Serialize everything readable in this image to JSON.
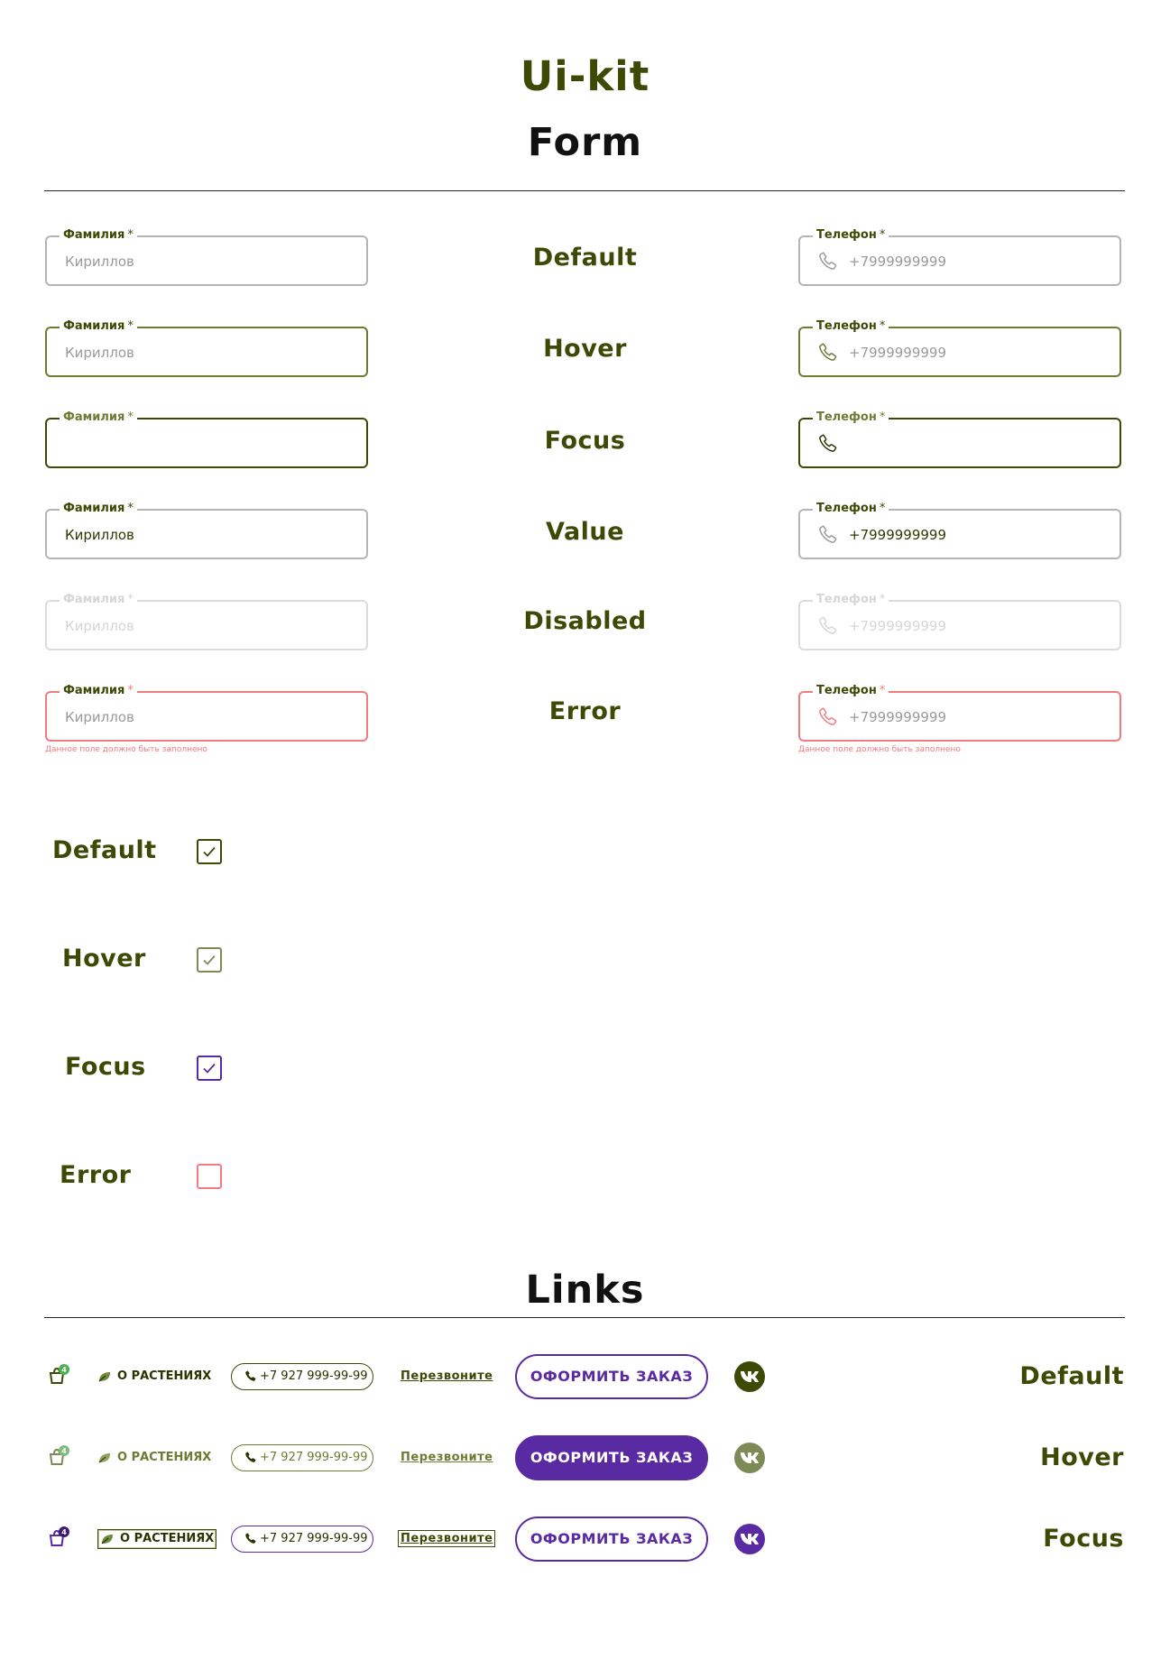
{
  "page": {
    "title": "Ui-kit"
  },
  "sections": {
    "form": "Form",
    "links": "Links"
  },
  "form": {
    "surname_label": "Фамилия",
    "phone_label": "Телефон",
    "required_mark": "*",
    "surname_value": "Кириллов",
    "phone_value": "+7999999999",
    "error_message": "Данное поле должно быть заполнено",
    "states": [
      "Default",
      "Hover",
      "Focus",
      "Value",
      "Disabled",
      "Error"
    ]
  },
  "checkboxes": {
    "states": [
      "Default",
      "Hover",
      "Focus",
      "Error"
    ],
    "checked": [
      true,
      true,
      true,
      false
    ]
  },
  "links": {
    "states": [
      "Default",
      "Hover",
      "Focus"
    ],
    "cart_count": "4",
    "about_label": "О РАСТЕНИЯХ",
    "phone": "+7 927 999-99-99",
    "callback": "Перезвоните",
    "order_button": "ОФОРМИТЬ ЗАКАЗ"
  },
  "colors": {
    "brand_green": "#3d4a05",
    "hover_green": "#6f7a32",
    "accent_purple": "#5a2aa2",
    "error_red": "#f07c80",
    "badge_green": "#4caf50"
  },
  "icons": [
    "phone-icon",
    "cart-icon",
    "leaf-icon",
    "vk-icon",
    "check-icon"
  ]
}
